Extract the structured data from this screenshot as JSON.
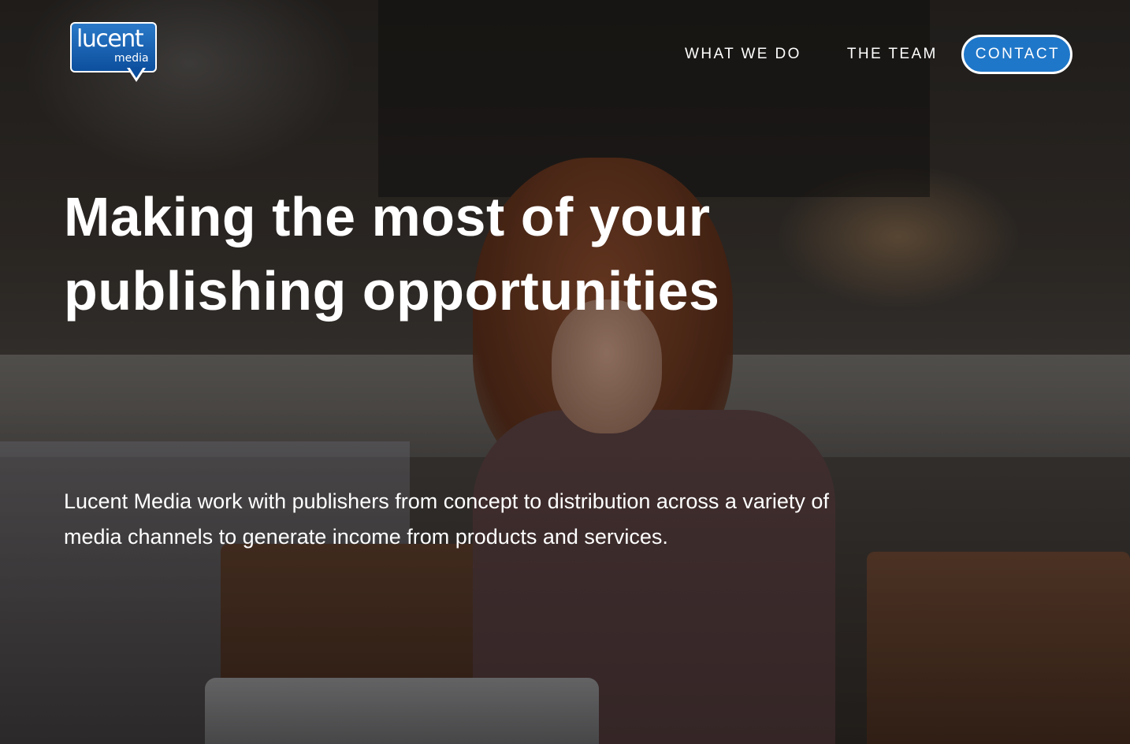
{
  "logo": {
    "word1": "lucent",
    "word2": "media"
  },
  "nav": {
    "what_we_do": "WHAT WE DO",
    "the_team": "THE TEAM",
    "contact": "CONTACT"
  },
  "hero": {
    "headline_line1": "Making the most of your",
    "headline_line2": "publishing opportunities",
    "subtext_line1": "Lucent Media work with publishers from concept to distribution across a variety of",
    "subtext_line2": "media channels to generate income from products and services."
  },
  "colors": {
    "accent": "#1f77c9",
    "logo_blue": "#0c4f9e",
    "text": "#ffffff"
  }
}
